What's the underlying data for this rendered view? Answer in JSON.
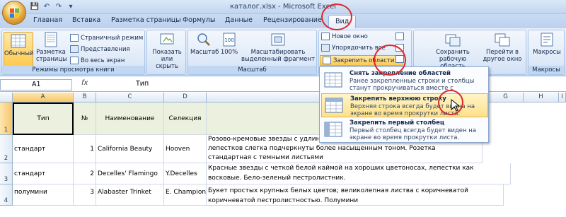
{
  "window": {
    "title": "каталог.xlsx - Microsoft Excel"
  },
  "qat": {
    "icons": [
      "save-icon",
      "undo-icon",
      "redo-icon",
      "dropdown-arrow-icon"
    ]
  },
  "tabs": [
    "Главная",
    "Вставка",
    "Разметка страницы",
    "Формулы",
    "Данные",
    "Рецензирование",
    "Вид"
  ],
  "active_tab": "Вид",
  "ribbon": {
    "group1": {
      "label": "Режимы просмотра книги",
      "normal": "Обычный",
      "page_layout": "Разметка страницы",
      "page_break": "Страничный режим",
      "views": "Представления",
      "fullscreen": "Во весь экран"
    },
    "group2": {
      "show_hide": "Показать или скрыть"
    },
    "group3": {
      "label": "Масштаб",
      "zoom": "Масштаб",
      "zoom100": "100%",
      "zoom_selection": "Масштабировать выделенный фрагмент"
    },
    "group4": {
      "new_window": "Новое окно",
      "arrange": "Упорядочить все",
      "freeze": "Закрепить области"
    },
    "group5": {
      "save_workspace": "Сохранить рабочую область",
      "switch_window": "Перейти в другое окно"
    },
    "group6": {
      "label": "Макросы",
      "macros": "Макросы"
    }
  },
  "formula_bar": {
    "name_box": "A1",
    "fx": "fx",
    "value": "Тип"
  },
  "columns": [
    "A",
    "B",
    "C",
    "D",
    "E",
    "F",
    "G",
    "H",
    "I"
  ],
  "rows": [
    "1",
    "2",
    "3",
    "4"
  ],
  "cells": {
    "header": {
      "a": "Тип",
      "b": "№",
      "c": "Наименование",
      "d": "Селекция"
    },
    "r2": {
      "a": "стандарт",
      "b": "1",
      "c": "California Beauty",
      "d": "Hooven",
      "e1": "Розово-кремовые звезды с удлинен",
      "e2": "лепестков слегка подчеркнуты более насыщенным тоном. Розетка",
      "e3": "стандартная с темными листьями"
    },
    "r3": {
      "a": "стандарт",
      "b": "2",
      "c": "Decelles' Flamingo",
      "d": "Y.Decelles",
      "e1": "Красные звезды с четкой белой каймой на хороших цветоносах, лепестки как",
      "e2": "восковые. Бело-зеленый пестролистник."
    },
    "r4": {
      "a": "полумини",
      "b": "3",
      "c": "Alabaster Trinket",
      "d": "E. Champion",
      "e1": "Букет простых крупных белых цветов; великолепная листва с коричневатой",
      "e2": "коричневатой пестролистностью. Полумини"
    }
  },
  "freeze_menu": [
    {
      "title": "Снять закрепление областей",
      "desc": "Ранее закрепленные строки и столбцы станут прокручиваться вместе с остальным листом."
    },
    {
      "title": "Закрепить верхнюю строку",
      "desc": "Верхняя строка всегда будет видна на экране во время прокрутки листа."
    },
    {
      "title": "Закрепить первый столбец",
      "desc": "Первый столбец всегда будет виден на экране во время прокрутки листа."
    }
  ],
  "colors": {
    "accent": "#e0262a",
    "highlight": "#ffe08a",
    "ribbon": "#d6e4f6",
    "header_fill": "#ebf1de"
  }
}
